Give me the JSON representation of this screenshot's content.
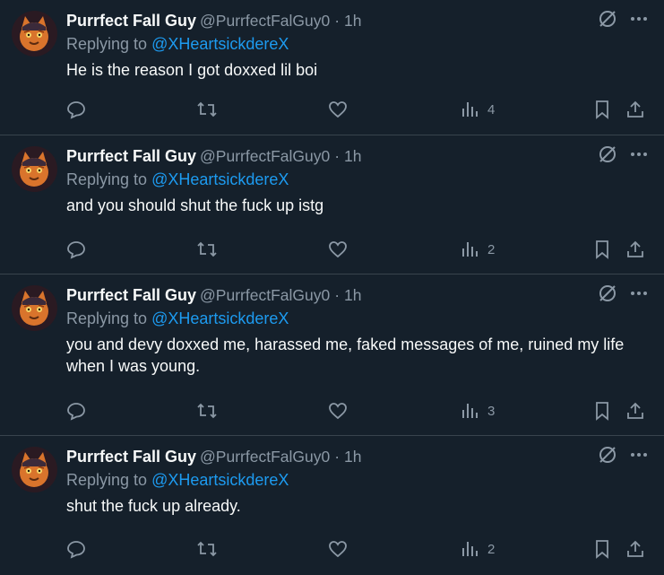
{
  "colors": {
    "background": "#15202b",
    "divider": "#38444d",
    "secondary_text": "#8b98a5",
    "link": "#1d9bf0",
    "primary_text": "#f7f9f9"
  },
  "icons": {
    "grok": "grok-icon",
    "more": "more-icon",
    "reply": "reply-icon",
    "retweet": "retweet-icon",
    "like": "heart-icon",
    "views": "views-icon",
    "bookmark": "bookmark-icon",
    "share": "share-icon"
  },
  "tweets": [
    {
      "name": "Purrfect Fall Guy",
      "handle": "@PurrfectFalGuy0",
      "separator": "·",
      "time": "1h",
      "replying_prefix": "Replying to",
      "replying_to": "@XHeartsickdereX",
      "text": "He is the reason I got doxxed lil boi",
      "views": "4"
    },
    {
      "name": "Purrfect Fall Guy",
      "handle": "@PurrfectFalGuy0",
      "separator": "·",
      "time": "1h",
      "replying_prefix": "Replying to",
      "replying_to": "@XHeartsickdereX",
      "text": "and you should shut the fuck up istg",
      "views": "2"
    },
    {
      "name": "Purrfect Fall Guy",
      "handle": "@PurrfectFalGuy0",
      "separator": "·",
      "time": "1h",
      "replying_prefix": "Replying to",
      "replying_to": "@XHeartsickdereX",
      "text": "you and devy doxxed me, harassed me, faked messages of me, ruined my life when I was young.",
      "views": "3"
    },
    {
      "name": "Purrfect Fall Guy",
      "handle": "@PurrfectFalGuy0",
      "separator": "·",
      "time": "1h",
      "replying_prefix": "Replying to",
      "replying_to": "@XHeartsickdereX",
      "text": "shut the fuck up already.",
      "views": "2"
    }
  ]
}
